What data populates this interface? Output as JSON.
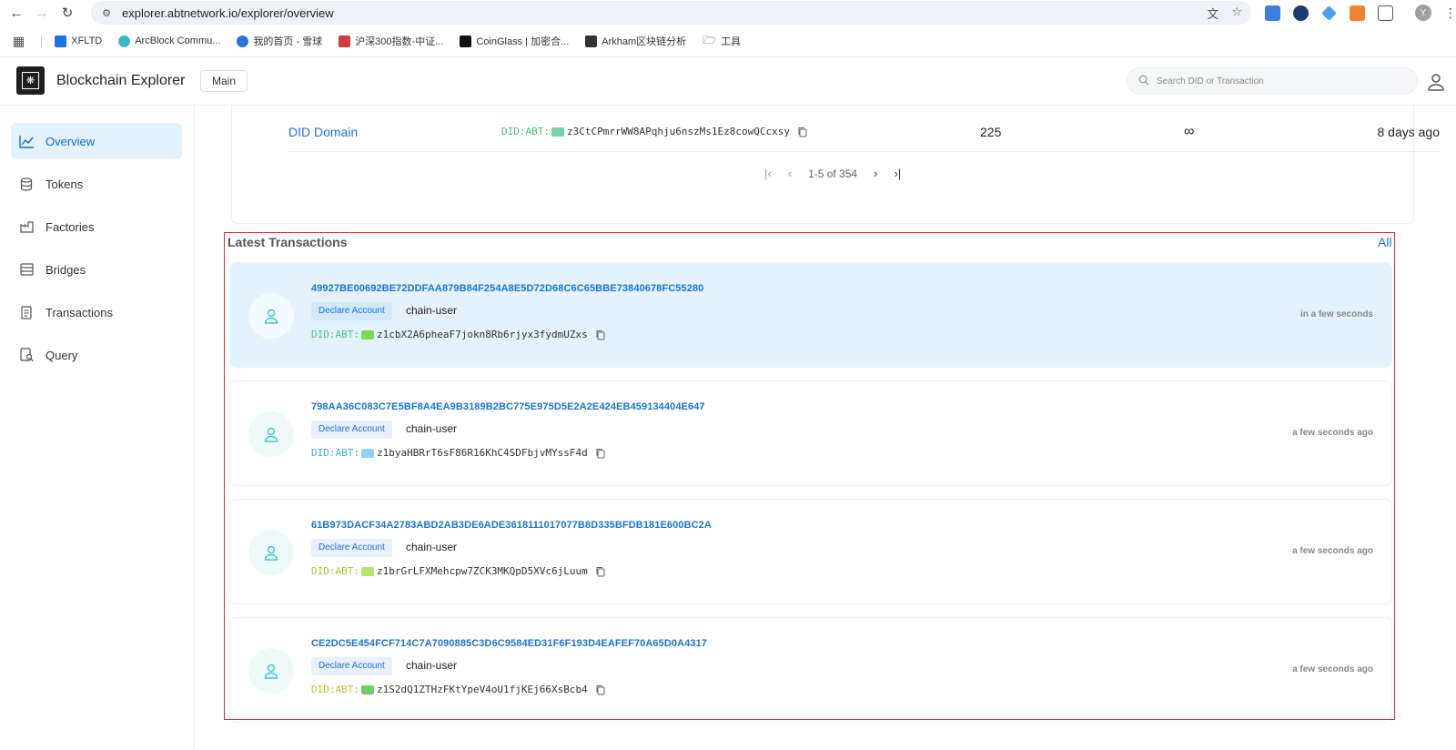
{
  "browser": {
    "url": "explorer.abtnetwork.io/explorer/overview",
    "profile_initial": "Y",
    "bookmarks": [
      {
        "label": "XFLTD",
        "color": "#1a73e8"
      },
      {
        "label": "ArcBlock Commu...",
        "color": "#39b8c9"
      },
      {
        "label": "我的首页 - 雪球",
        "color": "#2b6fd6"
      },
      {
        "label": "沪深300指数-中证...",
        "color": "#d23b3b"
      },
      {
        "label": "CoinGlass | 加密合...",
        "color": "#111111"
      },
      {
        "label": "Arkham区块链分析",
        "color": "#333333"
      },
      {
        "label": "工具",
        "color": "#555555"
      }
    ]
  },
  "header": {
    "title": "Blockchain Explorer",
    "chain_label": "Main",
    "search_placeholder": "Search DID or Transaction"
  },
  "sidebar": {
    "items": [
      {
        "label": "Overview",
        "icon": "chart-line-icon",
        "active": true
      },
      {
        "label": "Tokens",
        "icon": "coins-icon",
        "active": false
      },
      {
        "label": "Factories",
        "icon": "factory-icon",
        "active": false
      },
      {
        "label": "Bridges",
        "icon": "bridge-icon",
        "active": false
      },
      {
        "label": "Transactions",
        "icon": "document-icon",
        "active": false
      },
      {
        "label": "Query",
        "icon": "query-icon",
        "active": false
      }
    ]
  },
  "did_row": {
    "name": "DID Domain",
    "did_prefix": "DID:ABT:",
    "address": "z3CtCPmrrWW8APqhju6nszMs1Ez8cowQCcxsy",
    "count": "225",
    "limit": "∞",
    "time": "8 days ago"
  },
  "pagination": {
    "range": "1-5 of 354"
  },
  "latest_transactions": {
    "title": "Latest Transactions",
    "all_link": "All",
    "items": [
      {
        "hash": "49927BE00692BE72DDFAA879B84F254A8E5D72D68C6C65BBE73840678FC55280",
        "type": "Declare Account",
        "sender": "chain-user",
        "did_prefix": "DID:ABT:",
        "address": "z1cbX2A6pheaF7jokn8Rb6rjyx3fydmUZxs",
        "time": "in a few seconds",
        "badge_color": "#7ed957"
      },
      {
        "hash": "798AA36C083C7E5BF8A4EA9B3189B2BC775E975D5E2A2E424EB459134404E647",
        "type": "Declare Account",
        "sender": "chain-user",
        "did_prefix": "DID:ABT:",
        "address": "z1byaHBRrT6sF86R16KhC4SDFbjvMYssF4d",
        "time": "a few seconds ago",
        "badge_color": "#8fd3f4"
      },
      {
        "hash": "61B973DACF34A2783ABD2AB3DE6ADE3618111017077B8D335BFDB181E600BC2A",
        "type": "Declare Account",
        "sender": "chain-user",
        "did_prefix": "DID:ABT:",
        "address": "z1brGrLFXMehcpw7ZCK3MKQpD5XVc6jLuum",
        "time": "a few seconds ago",
        "badge_color": "#b5e36b"
      },
      {
        "hash": "CE2DC5E454FCF714C7A7090885C3D6C9584ED31F6F193D4EAFEF70A65D0A4317",
        "type": "Declare Account",
        "sender": "chain-user",
        "did_prefix": "DID:ABT:",
        "address": "z1S2dQ1ZTHzFKtYpeV4oU1fjKEj66XsBcb4",
        "time": "a few seconds ago",
        "badge_color": "#6ccf6c"
      }
    ]
  },
  "colors": {
    "accent": "#1b74d3",
    "active_bg": "#e3f2fd",
    "highlight_border": "#e22c35",
    "avatar": "#3fc7c9"
  }
}
